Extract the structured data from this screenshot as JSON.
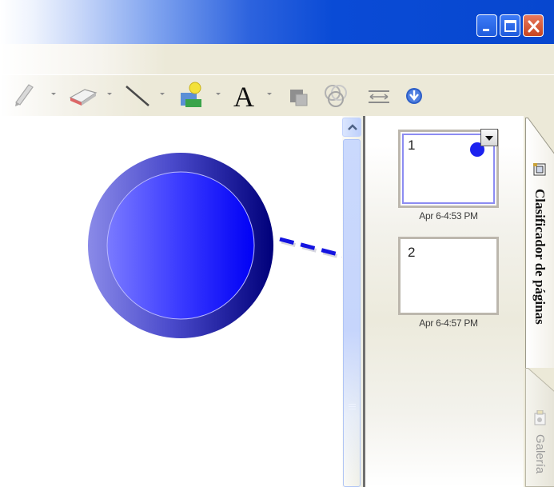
{
  "window": {
    "controls": {
      "minimize_icon": "minimize-icon",
      "maximize_icon": "maximize-icon",
      "close_icon": "close-icon"
    }
  },
  "toolbar": {
    "tools": [
      {
        "name": "pen-tool",
        "icon": "pen-icon",
        "dropdown": true
      },
      {
        "name": "eraser-tool",
        "icon": "eraser-icon",
        "dropdown": true
      },
      {
        "name": "line-tool",
        "icon": "line-icon",
        "dropdown": true
      },
      {
        "name": "fill-tool",
        "icon": "shapes-fill-icon",
        "dropdown": true
      },
      {
        "name": "text-tool",
        "icon": "text-icon",
        "glyph": "A",
        "dropdown": true
      },
      {
        "name": "arrange-tool",
        "icon": "arrange-icon",
        "dropdown": false
      },
      {
        "name": "color-tool",
        "icon": "color-wheel-icon",
        "dropdown": false
      },
      {
        "name": "page-width-tool",
        "icon": "page-width-icon",
        "dropdown": false
      },
      {
        "name": "more-tools",
        "icon": "chevron-down-circle-icon",
        "dropdown": false
      }
    ]
  },
  "canvas": {
    "shapes": [
      {
        "type": "circle",
        "color_outer": "#0d0d96",
        "color_inner": "#0000ff"
      },
      {
        "type": "dashed-arrow",
        "color": "#1414e0"
      }
    ]
  },
  "page_sorter": {
    "pages": [
      {
        "number": "1",
        "timestamp": "Apr 6-4:53 PM",
        "selected": true
      },
      {
        "number": "2",
        "timestamp": "Apr 6-4:57 PM",
        "selected": false
      }
    ]
  },
  "side_tabs": [
    {
      "label": "Clasificador de páginas",
      "icon": "page-sorter-icon",
      "active": true
    },
    {
      "label": "Galería",
      "icon": "gallery-icon",
      "active": false
    }
  ]
}
